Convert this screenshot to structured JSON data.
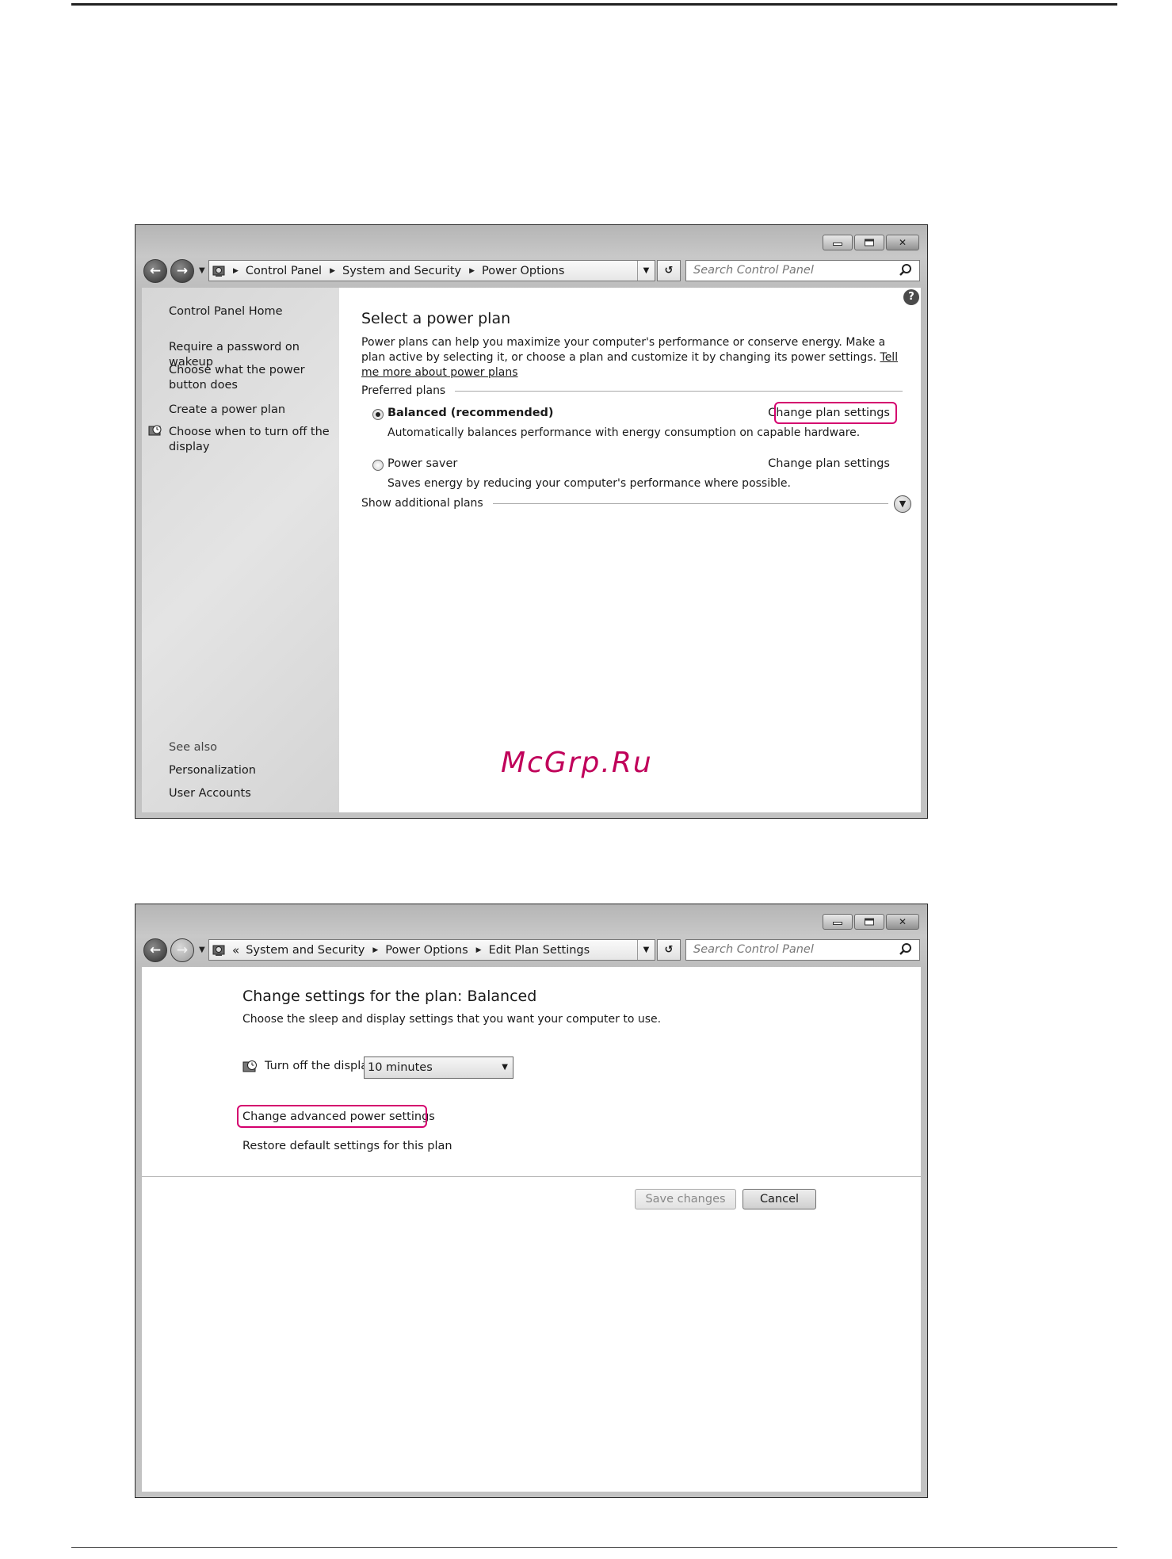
{
  "window1": {
    "breadcrumb": [
      "Control Panel",
      "System and Security",
      "Power Options"
    ],
    "search_placeholder": "Search Control Panel",
    "sidebar": {
      "home": "Control Panel Home",
      "items": [
        "Require a password on wakeup",
        "Choose what the power button does",
        "Create a power plan",
        "Choose when to turn off the display"
      ],
      "see_also_label": "See also",
      "see_also": [
        "Personalization",
        "User Accounts"
      ]
    },
    "title": "Select a power plan",
    "intro": "Power plans can help you maximize your computer's performance or conserve energy. Make a plan active by selecting it, or choose a plan and customize it by changing its power settings.",
    "intro_link": "Tell me more about power plans",
    "preferred_label": "Preferred plans",
    "plans": [
      {
        "name": "Balanced (recommended)",
        "desc": "Automatically balances performance with energy consumption on capable hardware.",
        "link": "Change plan settings",
        "selected": true
      },
      {
        "name": "Power saver",
        "desc": "Saves energy by reducing your computer's performance where possible.",
        "link": "Change plan settings",
        "selected": false
      }
    ],
    "additional_label": "Show additional plans"
  },
  "watermark": "McGrp.Ru",
  "window2": {
    "breadcrumb_prefix": "«",
    "breadcrumb": [
      "System and Security",
      "Power Options",
      "Edit Plan Settings"
    ],
    "search_placeholder": "Search Control Panel",
    "title": "Change settings for the plan: Balanced",
    "subtitle": "Choose the sleep and display settings that you want your computer to use.",
    "display_label": "Turn off the display:",
    "display_value": "10 minutes",
    "advanced_link": "Change advanced power settings",
    "restore_link": "Restore default settings for this plan",
    "save_label": "Save changes",
    "cancel_label": "Cancel"
  },
  "colors": {
    "highlight": "#d4006e",
    "watermark": "#c0005a"
  },
  "icons": [
    "back-arrow-icon",
    "forward-arrow-icon",
    "control-panel-icon",
    "refresh-icon",
    "search-icon",
    "help-icon",
    "display-timer-icon",
    "chevron-down-icon"
  ]
}
